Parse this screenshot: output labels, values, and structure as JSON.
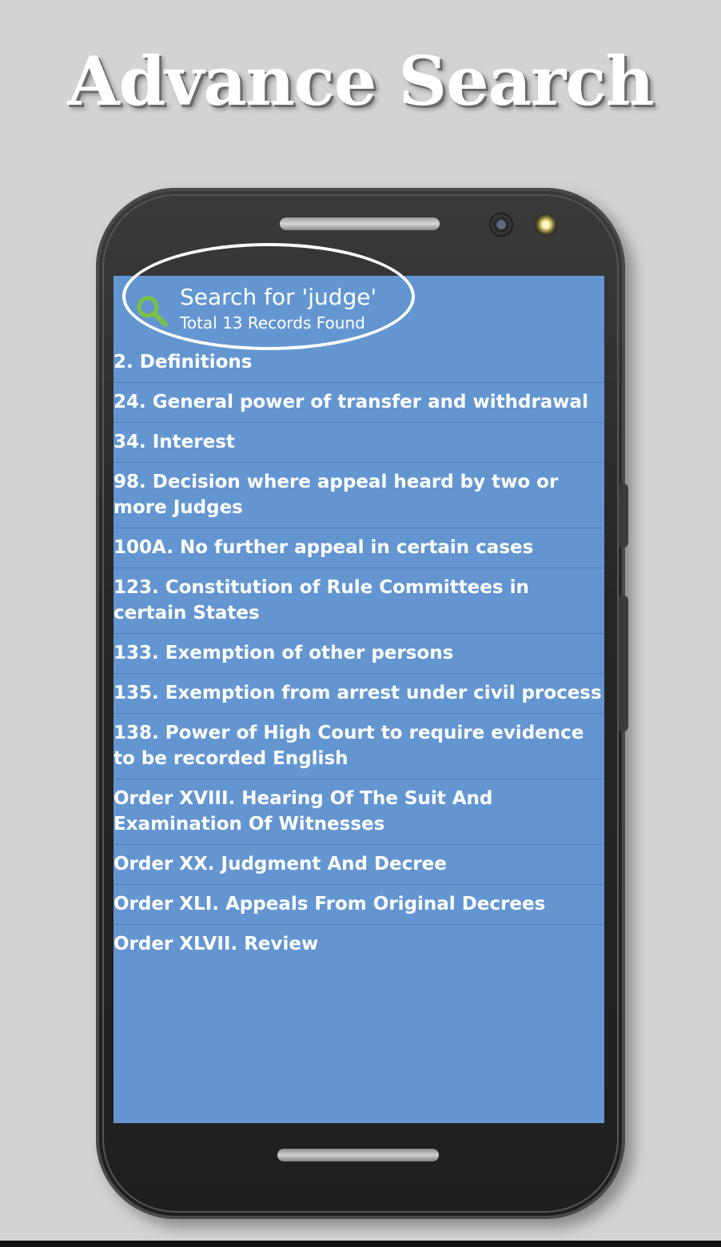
{
  "promo": {
    "title": "Advance Search"
  },
  "header": {
    "title": "Search for 'judge'",
    "subtitle": "Total 13 Records Found",
    "icon": "search-icon"
  },
  "colors": {
    "screen_background": "#6396d1",
    "icon_green": "#7cc242",
    "text": "#ffffff"
  },
  "results": [
    "2. Definitions",
    "24. General power of transfer and withdrawal",
    "34. Interest",
    "98. Decision where appeal heard by two or more Judges",
    "100A. No further appeal in certain cases",
    "123. Constitution of Rule Committees in certain States",
    "133. Exemption of other persons",
    "135. Exemption from arrest under civil process",
    "138. Power of High Court to require evidence to be recorded English",
    "Order XVIII. Hearing Of The Suit And Examination Of Witnesses",
    "Order XX. Judgment And Decree",
    "Order XLI. Appeals From Original Decrees",
    "Order XLVII. Review"
  ]
}
